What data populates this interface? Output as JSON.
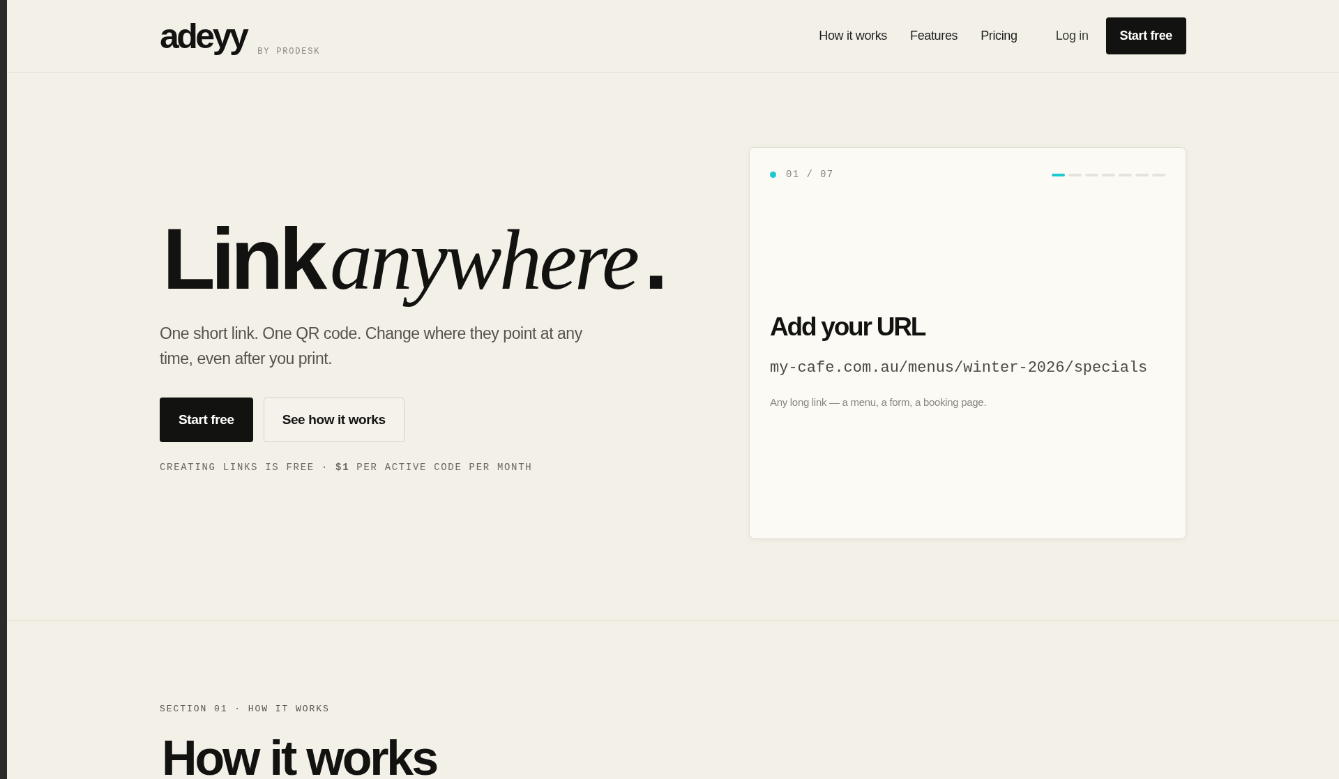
{
  "logo": {
    "wordmark": "adeyy",
    "byline": "BY PRODESK"
  },
  "nav": {
    "links": [
      "How it works",
      "Features",
      "Pricing"
    ],
    "login": "Log in",
    "cta": "Start free"
  },
  "hero": {
    "headline": [
      {
        "text": "Link",
        "kind": "sans"
      },
      {
        "text": "anywhere",
        "kind": "serif"
      },
      {
        "text": ".",
        "kind": "sans"
      }
    ],
    "subtitle": "One short link. One QR code. Change where they point at any time, even after you print.",
    "buttons": [
      {
        "label": "Start free",
        "kind": "primary"
      },
      {
        "label": "See how it works",
        "kind": "secondary"
      }
    ],
    "caption": "CREATING LINKS IS FREE · **$1** PER ACTIVE CODE PER MONTH"
  },
  "card": {
    "counter": "01 / 07",
    "steps": [
      {
        "selected": true
      },
      {
        "selected": false
      },
      {
        "selected": false
      },
      {
        "selected": false
      },
      {
        "selected": false
      },
      {
        "selected": false
      },
      {
        "selected": false
      }
    ],
    "title": "Add your URL",
    "url": "my-cafe.com.au/menus/winter-2026/specials",
    "hint": "Any long link — a menu, a form, a booking page."
  },
  "section": {
    "label": "SECTION 01 · HOW IT WORKS",
    "title": "How it works"
  }
}
